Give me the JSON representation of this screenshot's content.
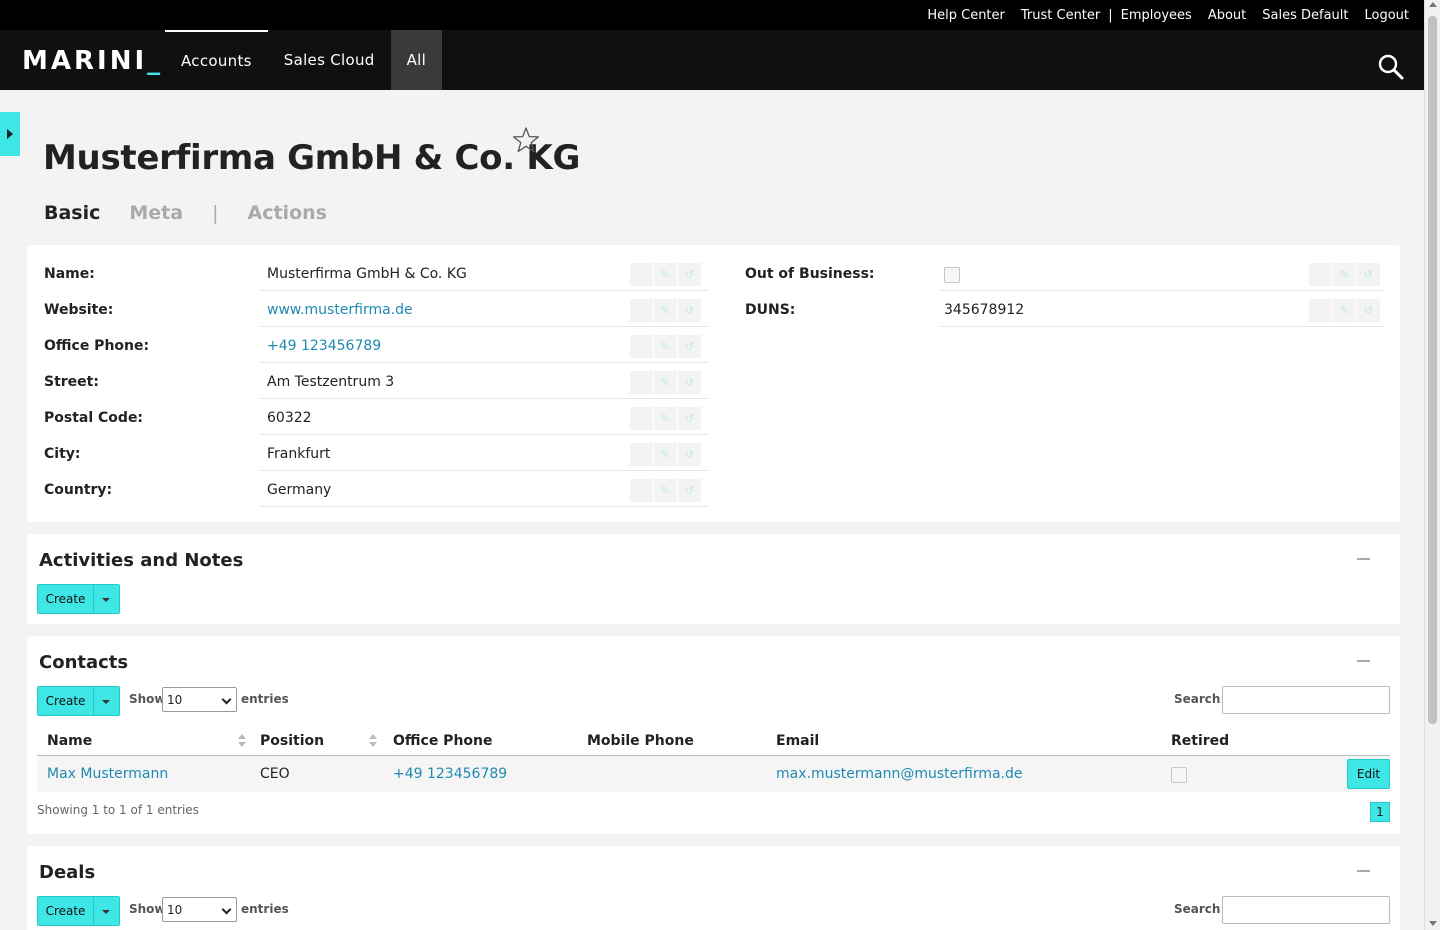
{
  "topbar": {
    "links": [
      "Help Center",
      "Trust Center",
      "|",
      "Employees",
      "About",
      "Sales Default",
      "Logout"
    ]
  },
  "nav": {
    "logo": "MARINI",
    "logo_suffix": "_",
    "tabs": [
      "Accounts",
      "Sales Cloud",
      "All"
    ]
  },
  "page": {
    "title": "Musterfirma GmbH & Co. KG",
    "subtabs": [
      "Basic",
      "Meta",
      "|",
      "Actions"
    ]
  },
  "basic": {
    "left_fields": [
      {
        "label": "Name:",
        "value": "Musterfirma GmbH & Co. KG",
        "link": false
      },
      {
        "label": "Website:",
        "value": "www.musterfirma.de",
        "link": true
      },
      {
        "label": "Office Phone:",
        "value": "+49 123456789",
        "link": true
      },
      {
        "label": "Street:",
        "value": "Am Testzentrum 3",
        "link": false
      },
      {
        "label": "Postal Code:",
        "value": "60322",
        "link": false
      },
      {
        "label": "City:",
        "value": "Frankfurt",
        "link": false
      },
      {
        "label": "Country:",
        "value": "Germany",
        "link": false
      }
    ],
    "right_fields": [
      {
        "label": "Out of Business:",
        "value": "",
        "checkbox": true,
        "checked": false
      },
      {
        "label": "DUNS:",
        "value": "345678912",
        "checkbox": false
      }
    ]
  },
  "activities": {
    "title": "Activities and Notes",
    "create_label": "Create"
  },
  "contacts": {
    "title": "Contacts",
    "create_label": "Create",
    "show_label": "Show",
    "entries_label": "entries",
    "page_size": "10",
    "search_label": "Search:",
    "columns": [
      "Name",
      "Position",
      "Office Phone",
      "Mobile Phone",
      "Email",
      "Retired"
    ],
    "rows": [
      {
        "name": "Max Mustermann",
        "position": "CEO",
        "office_phone": "+49 123456789",
        "mobile_phone": "",
        "email": "max.mustermann@musterfirma.de",
        "retired": false,
        "edit_label": "Edit"
      }
    ],
    "info": "Showing 1 to 1 of 1 entries",
    "page": "1"
  },
  "deals": {
    "title": "Deals",
    "create_label": "Create",
    "show_label": "Show",
    "entries_label": "entries",
    "page_size": "10",
    "search_label": "Search:"
  },
  "colors": {
    "accent": "#3fe6e6",
    "link": "#1f8ab0",
    "topbar": "#000000",
    "navbar": "#101010"
  }
}
